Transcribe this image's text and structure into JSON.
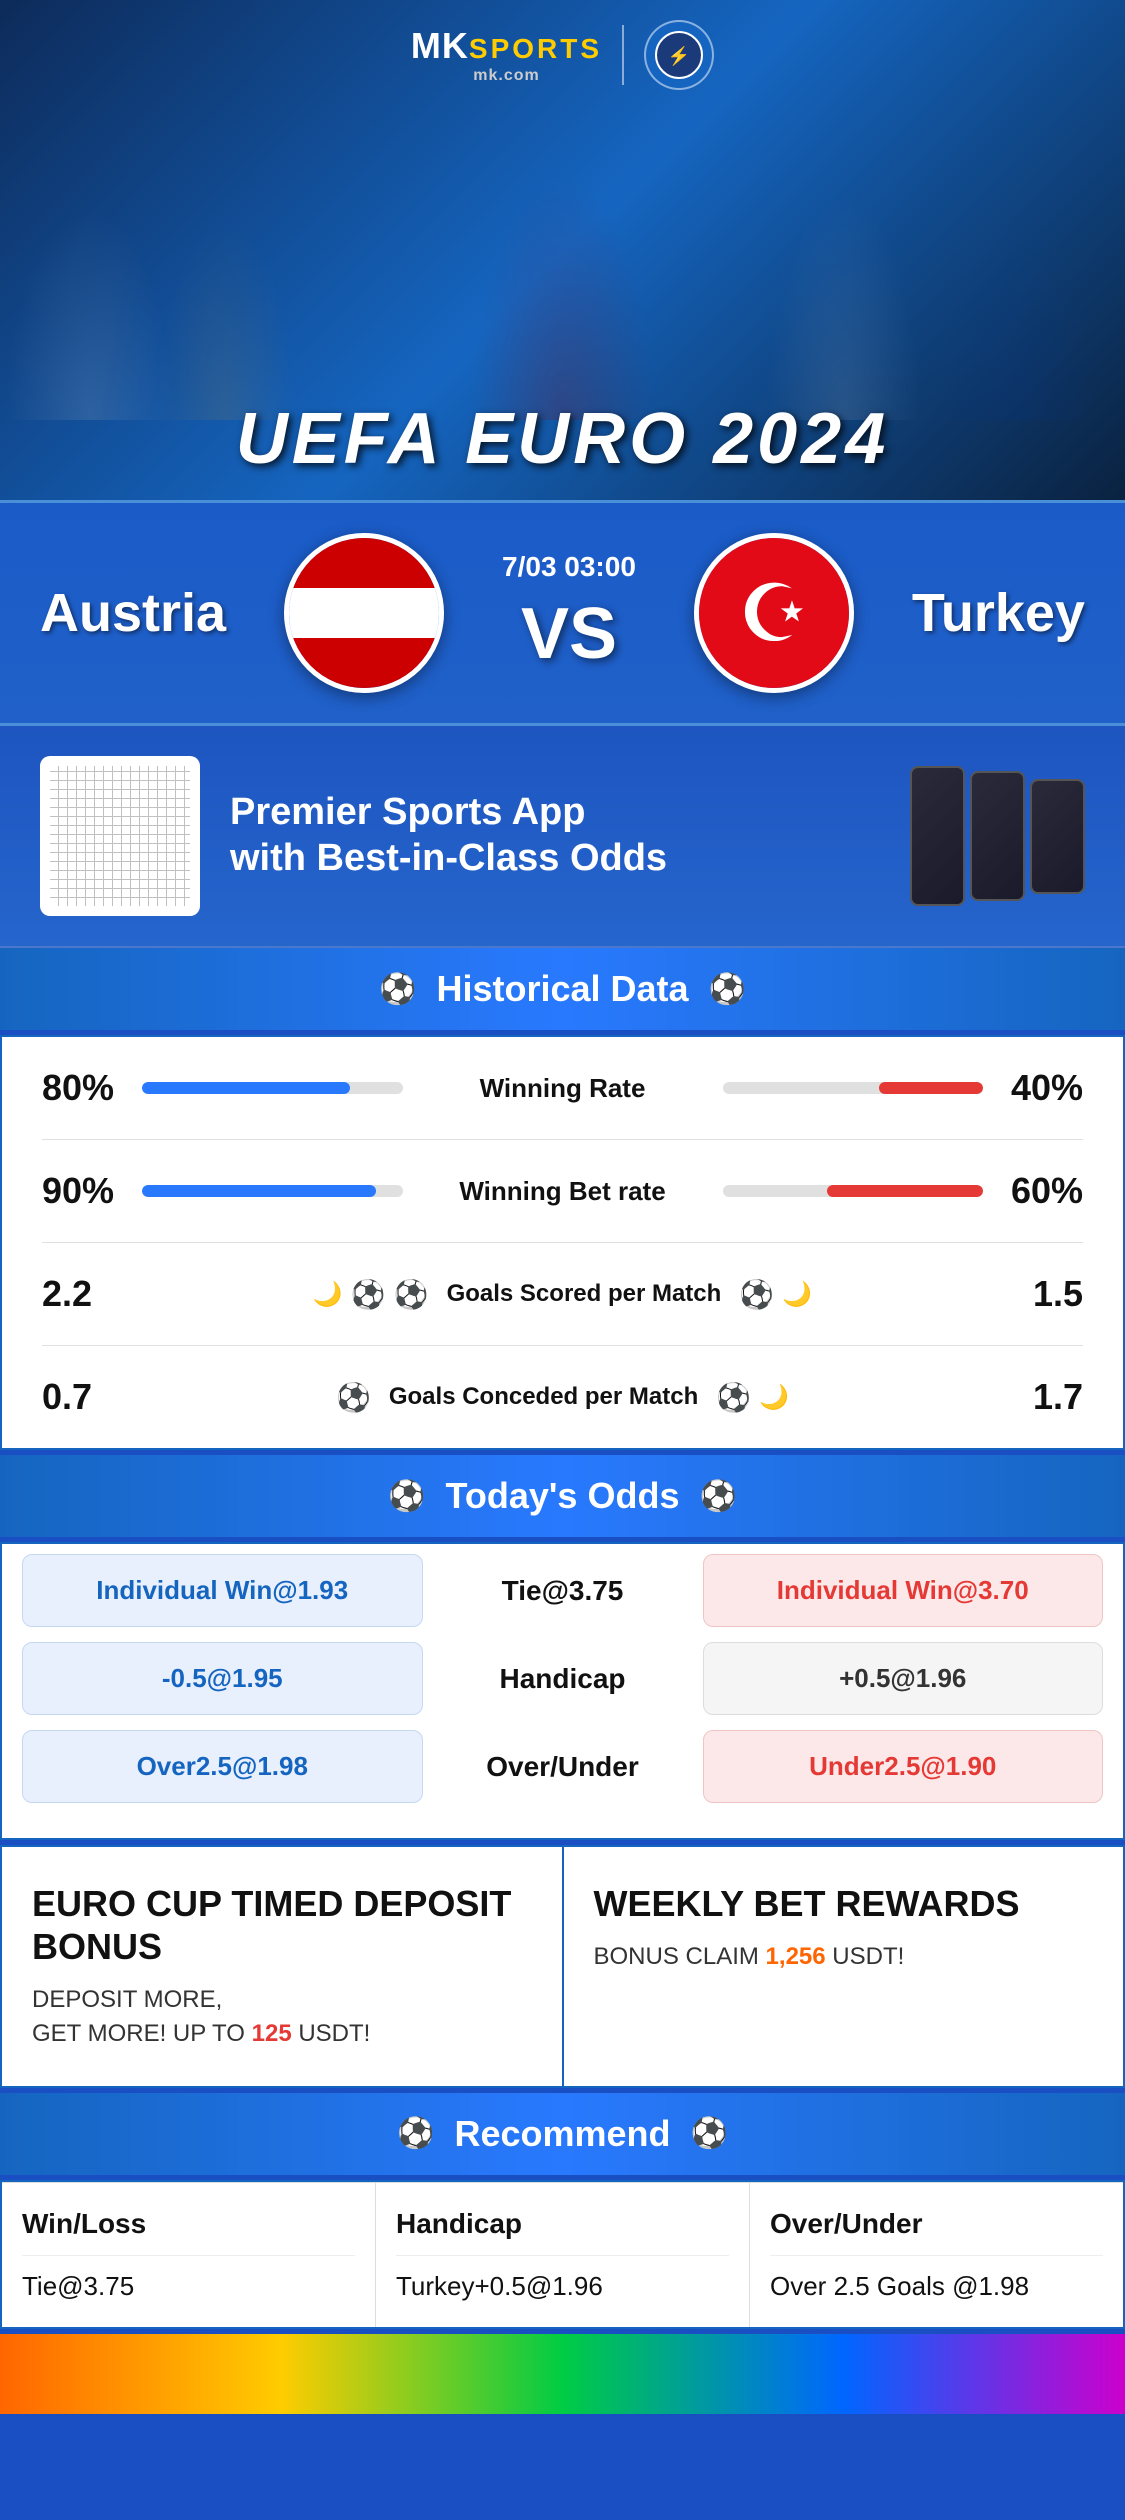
{
  "brand": {
    "name_mk": "MK",
    "name_sports": "SPORTS",
    "domain": "mk.com",
    "divider": "|"
  },
  "hero": {
    "title": "UEFA EURO 2024"
  },
  "match": {
    "team_left": "Austria",
    "team_right": "Turkey",
    "date_time": "7/03 03:00",
    "vs": "VS"
  },
  "app_promo": {
    "headline_line1": "Premier Sports App",
    "headline_line2": "with Best-in-Class Odds"
  },
  "historical": {
    "section_title": "Historical Data",
    "stats": [
      {
        "label": "Winning Rate",
        "left_value": "80%",
        "right_value": "40%",
        "left_pct": 80,
        "right_pct": 40
      },
      {
        "label": "Winning Bet rate",
        "left_value": "90%",
        "right_value": "60%",
        "left_pct": 90,
        "right_pct": 60
      },
      {
        "label": "Goals Scored per Match",
        "left_value": "2.2",
        "right_value": "1.5",
        "icons_left": "⚽⚽",
        "icons_right": "⚽"
      },
      {
        "label": "Goals Conceded per Match",
        "left_value": "0.7",
        "right_value": "1.7",
        "icons": "⚽⚽"
      }
    ]
  },
  "odds": {
    "section_title": "Today's Odds",
    "rows": [
      {
        "left_label": "Individual Win@1.93",
        "center_label": "Tie@3.75",
        "right_label": "Individual Win@3.70",
        "left_type": "blue",
        "right_type": "red"
      },
      {
        "left_label": "-0.5@1.95",
        "center_label": "Handicap",
        "right_label": "+0.5@1.96",
        "left_type": "blue",
        "right_type": "white"
      },
      {
        "left_label": "Over2.5@1.98",
        "center_label": "Over/Under",
        "right_label": "Under2.5@1.90",
        "left_type": "blue",
        "right_type": "red"
      }
    ]
  },
  "bonus": {
    "left_title": "EURO CUP TIMED DEPOSIT BONUS",
    "left_desc_line1": "DEPOSIT MORE,",
    "left_desc_line2": "GET MORE! UP TO",
    "left_highlight": "125",
    "left_suffix": "USDT!",
    "right_title": "WEEKLY BET REWARDS",
    "right_desc": "BONUS CLAIM",
    "right_highlight": "1,256",
    "right_suffix": "USDT!"
  },
  "recommend": {
    "section_title": "Recommend",
    "columns": [
      {
        "header": "Win/Loss",
        "value": "Tie@3.75"
      },
      {
        "header": "Handicap",
        "value": "Turkey+0.5@1.96"
      },
      {
        "header": "Over/Under",
        "value": "Over 2.5 Goals @1.98"
      }
    ]
  },
  "icons": {
    "ball": "⚽",
    "crescent": "☪"
  }
}
